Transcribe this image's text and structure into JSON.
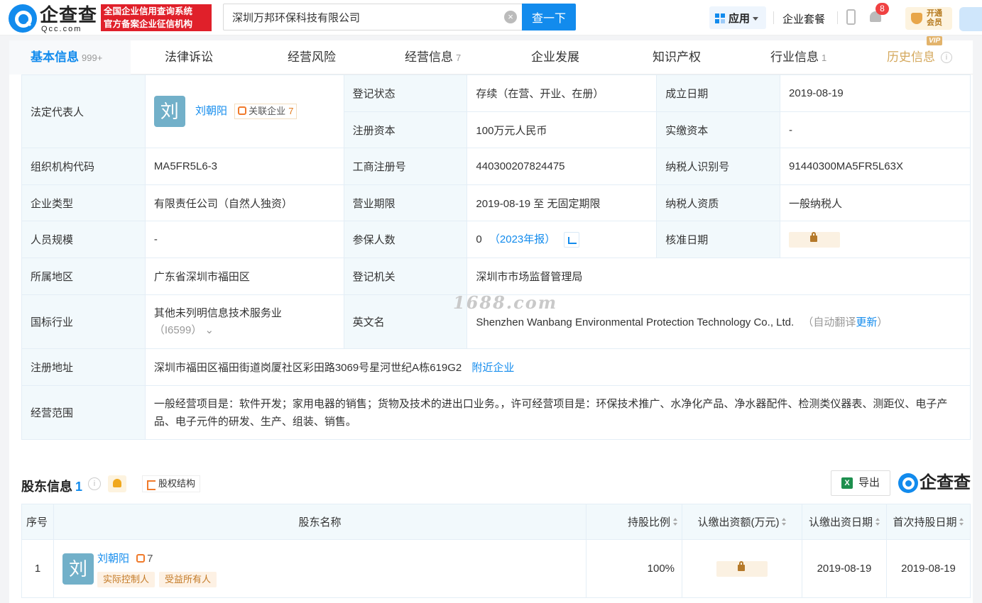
{
  "header": {
    "logo_title": "企查查",
    "logo_sub": "Qcc.com",
    "slogan_line1": "全国企业信用查询系统",
    "slogan_line2": "官方备案企业征信机构",
    "search_value": "深圳万邦环保科技有限公司",
    "search_button": "查一下",
    "app_label": "应用",
    "package_label": "企业套餐",
    "notification_count": "8",
    "vip_line1": "开通",
    "vip_line2": "会员"
  },
  "tabs": [
    {
      "label": "基本信息",
      "count": "999+",
      "active": true
    },
    {
      "label": "法律诉讼",
      "count": ""
    },
    {
      "label": "经营风险",
      "count": ""
    },
    {
      "label": "经营信息",
      "count": "7"
    },
    {
      "label": "企业发展",
      "count": ""
    },
    {
      "label": "知识产权",
      "count": ""
    },
    {
      "label": "行业信息",
      "count": "1"
    },
    {
      "label": "历史信息",
      "count": "",
      "vip": "VIP"
    }
  ],
  "info": {
    "legal_rep_label": "法定代表人",
    "legal_rep_avatar": "刘",
    "legal_rep_name": "刘朝阳",
    "related_label": "关联企业",
    "related_count": "7",
    "reg_status_label": "登记状态",
    "reg_status_value": "存续（在营、开业、在册）",
    "found_date_label": "成立日期",
    "found_date_value": "2019-08-19",
    "reg_capital_label": "注册资本",
    "reg_capital_value": "100万元人民币",
    "paid_capital_label": "实缴资本",
    "paid_capital_value": "-",
    "org_code_label": "组织机构代码",
    "org_code_value": "MA5FR5L6-3",
    "biz_reg_no_label": "工商注册号",
    "biz_reg_no_value": "440300207824475",
    "taxpayer_id_label": "纳税人识别号",
    "taxpayer_id_value": "91440300MA5FR5L63X",
    "company_type_label": "企业类型",
    "company_type_value": "有限责任公司（自然人独资）",
    "biz_term_label": "营业期限",
    "biz_term_value": "2019-08-19 至 无固定期限",
    "taxpayer_qual_label": "纳税人资质",
    "taxpayer_qual_value": "一般纳税人",
    "staff_size_label": "人员规模",
    "staff_size_value": "-",
    "insured_label": "参保人数",
    "insured_value": "0",
    "insured_year": "（2023年报）",
    "approve_date_label": "核准日期",
    "region_label": "所属地区",
    "region_value": "广东省深圳市福田区",
    "reg_authority_label": "登记机关",
    "reg_authority_value": "深圳市市场监督管理局",
    "industry_label": "国标行业",
    "industry_value": "其他未列明信息技术服务业",
    "industry_code": "（I6599）",
    "english_name_label": "英文名",
    "english_name_value": "Shenzhen Wanbang Environmental Protection Technology Co., Ltd.",
    "auto_translate": "（自动翻译",
    "update_link": "更新",
    "auto_translate_end": "）",
    "address_label": "注册地址",
    "address_value": "深圳市福田区福田街道岗厦社区彩田路3069号星河世纪A栋619G2",
    "nearby_link": "附近企业",
    "scope_label": "经营范围",
    "scope_value": "一般经营项目是：软件开发；家用电器的销售；货物及技术的进出口业务。，许可经营项目是：环保技术推广、水净化产品、净水器配件、检测类仪器表、测距仪、电子产品、电子元件的研发、生产、组装、销售。"
  },
  "watermark": "1688.com",
  "shareholders": {
    "title": "股东信息",
    "count": "1",
    "equity_button": "股权结构",
    "export_button": "导出",
    "logo_text": "企查查",
    "columns": [
      "序号",
      "股东名称",
      "持股比例",
      "认缴出资额(万元)",
      "认缴出资日期",
      "首次持股日期"
    ],
    "rows": [
      {
        "index": "1",
        "avatar": "刘",
        "name": "刘朝阳",
        "related_count": "7",
        "tags": [
          "实际控制人",
          "受益所有人"
        ],
        "ratio": "100%",
        "sub_date": "2019-08-19",
        "first_date": "2019-08-19"
      }
    ]
  }
}
